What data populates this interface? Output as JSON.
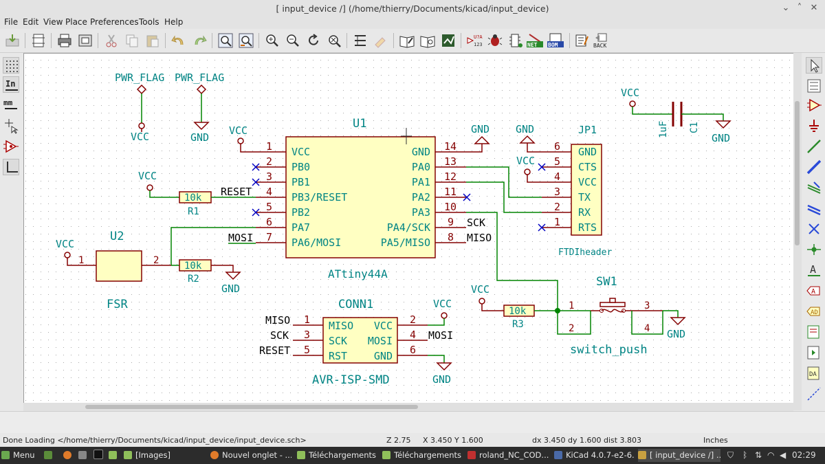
{
  "window": {
    "title": "[ input_device /] (/home/thierry/Documents/kicad/input_device)"
  },
  "menu": [
    "File",
    "Edit",
    "View",
    "Place",
    "Preferences",
    "Tools",
    "Help"
  ],
  "toolbar_icons": [
    "save-schematic-icon",
    "page-settings-icon",
    "print-icon",
    "plot-icon",
    "cut-icon",
    "copy-icon",
    "paste-icon",
    "undo-icon",
    "redo-icon",
    "find-icon",
    "find-replace-icon",
    "zoom-in-icon",
    "zoom-out-icon",
    "redraw-icon",
    "zoom-fit-icon",
    "hierarchy-navigator-icon",
    "leave-sheet-icon",
    "library-editor-icon",
    "library-browser-icon",
    "footprint-assign-icon",
    "annotate-icon",
    "erc-icon",
    "cvpcb-icon",
    "netlist-icon",
    "bom-icon",
    "import-footprint-icon",
    "back-annotate-icon"
  ],
  "toolbar_text": {
    "net": "NET",
    "bom": "BOM",
    "back": "BACK",
    "u2a": "U?A",
    "n123": "123"
  },
  "left_tools": [
    "grid-toggle-icon",
    "units-inch-icon",
    "units-mm-icon",
    "cursor-shape-icon",
    "hidden-pins-icon",
    "wire-angle-icon"
  ],
  "left_text": {
    "inch": "In",
    "mm": "mm"
  },
  "right_tools": [
    "select-arrow-icon",
    "hierarchy-navigator-icon",
    "place-component-icon",
    "place-power-icon",
    "draw-wire-icon",
    "draw-bus-icon",
    "wire-to-bus-entry-icon",
    "bus-to-bus-entry-icon",
    "no-connect-flag-icon",
    "junction-icon",
    "net-label-icon",
    "global-label-icon",
    "hierarchical-label-icon",
    "hierarchical-sheet-icon",
    "import-sheet-pin-icon",
    "add-sheet-pin-icon",
    "graphic-lines-icon"
  ],
  "right_text": {
    "label": "A"
  },
  "schematic": {
    "labels": {
      "pwr_flag_1": "PWR_FLAG",
      "pwr_flag_2": "PWR_FLAG",
      "pwr_flag_vcc": "VCC",
      "pwr_flag_gnd": "GND",
      "u1_ref": "U1",
      "u1_value": "ATtiny44A",
      "u1_vcc_power": "VCC",
      "u1_gnd_power": "GND",
      "u1_pins_left": [
        {
          "num": "1",
          "name": "VCC"
        },
        {
          "num": "2",
          "name": "PB0"
        },
        {
          "num": "3",
          "name": "PB1"
        },
        {
          "num": "4",
          "name": "PB3/RESET"
        },
        {
          "num": "5",
          "name": "PB2"
        },
        {
          "num": "6",
          "name": "PA7"
        },
        {
          "num": "7",
          "name": "PA6/MOSI"
        }
      ],
      "u1_pins_right": [
        {
          "num": "14",
          "name": "GND"
        },
        {
          "num": "13",
          "name": "PA0"
        },
        {
          "num": "12",
          "name": "PA1"
        },
        {
          "num": "11",
          "name": "PA2"
        },
        {
          "num": "10",
          "name": "PA3"
        },
        {
          "num": "9",
          "name": "PA4/SCK"
        },
        {
          "num": "8",
          "name": "PA5/MISO"
        }
      ],
      "reset_label": "RESET",
      "mosi_label_u1": "MOSI",
      "sck_label_u1": "SCK",
      "miso_label_u1": "MISO",
      "r1_value": "10k",
      "r1_ref": "R1",
      "r1_vcc": "VCC",
      "r2_value": "10k",
      "r2_ref": "R2",
      "r2_gnd": "GND",
      "u2_ref": "U2",
      "u2_value": "FSR",
      "u2_vcc": "VCC",
      "u2_pin1": "1",
      "u2_pin2": "2",
      "jp1_ref": "JP1",
      "jp1_value": "FTDIheader",
      "jp1_gnd": "GND",
      "jp1_vcc": "VCC",
      "jp1_pins": [
        {
          "num": "6",
          "name": "GND"
        },
        {
          "num": "5",
          "name": "CTS"
        },
        {
          "num": "4",
          "name": "VCC"
        },
        {
          "num": "3",
          "name": "TX"
        },
        {
          "num": "2",
          "name": "RX"
        },
        {
          "num": "1",
          "name": "RTS"
        }
      ],
      "c1_value": "1uF",
      "c1_ref": "C1",
      "c1_vcc": "VCC",
      "c1_gnd": "GND",
      "conn1_ref": "CONN1",
      "conn1_value": "AVR-ISP-SMD",
      "conn1_vcc": "VCC",
      "conn1_gnd": "GND",
      "conn1_pins_left": [
        {
          "num": "1",
          "name": "MISO",
          "net": "MISO"
        },
        {
          "num": "3",
          "name": "SCK",
          "net": "SCK"
        },
        {
          "num": "5",
          "name": "RST",
          "net": "RESET"
        }
      ],
      "conn1_pins_right": [
        {
          "num": "2",
          "name": "VCC"
        },
        {
          "num": "4",
          "name": "MOSI",
          "net": "MOSI"
        },
        {
          "num": "6",
          "name": "GND"
        }
      ],
      "r3_value": "10k",
      "r3_ref": "R3",
      "r3_vcc": "VCC",
      "sw1_ref": "SW1",
      "sw1_value": "switch_push",
      "sw1_pin1": "1",
      "sw1_pin2": "2",
      "sw1_pin3": "3",
      "sw1_pin4": "4",
      "sw1_gnd": "GND"
    }
  },
  "status": {
    "message": "Done Loading </home/thierry/Documents/kicad/input_device/input_device.sch>",
    "zoom": "Z 2.75",
    "cursor": "X 3.450  Y 1.600",
    "delta": "dx 3.450  dy 1.600  dist 3.803",
    "units": "Inches"
  },
  "taskbar": {
    "menu": "Menu",
    "tasks": [
      "[Images]",
      "Nouvel onglet - ...",
      "Téléchargements",
      "Téléchargements",
      "roland_NC_COD...",
      "KiCad 4.0.7-e2-6...",
      "[ input_device /] ..."
    ],
    "clock": "02:29"
  },
  "colors": {
    "wire": "#008400",
    "component": "#840000",
    "pin_text": "#008484",
    "body_fill": "#ffffc2",
    "noconnect": "#0000c2",
    "canvas": "#ffffff",
    "grid": "#b0b0b0"
  }
}
